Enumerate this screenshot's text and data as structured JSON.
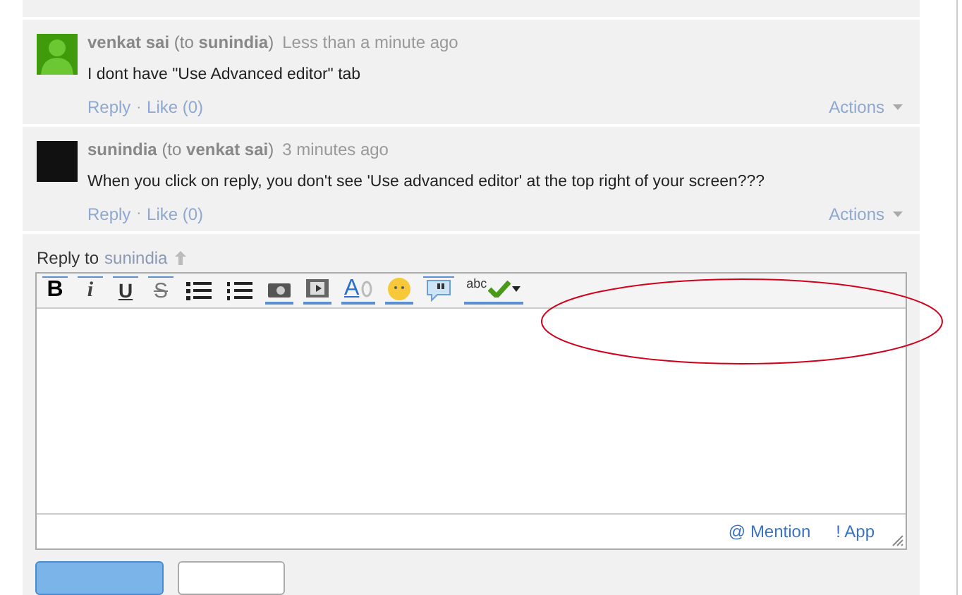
{
  "comments": [
    {
      "kind": "silhouette",
      "author": "venkat sai",
      "to_open": "(to",
      "to": "sunindia",
      "to_close": ")",
      "time": "Less than a minute ago",
      "body": "I dont have \"Use Advanced editor\" tab",
      "reply": "Reply",
      "separator": "·",
      "like": "Like (0)",
      "actions": "Actions"
    },
    {
      "kind": "photo",
      "author": "sunindia",
      "to_open": "(to",
      "to": "venkat sai",
      "to_close": ")",
      "time": "3 minutes ago",
      "body": "When you click on reply, you don't see 'Use advanced editor' at the top right of your screen???",
      "reply": "Reply",
      "separator": "·",
      "like": "Like (0)",
      "actions": "Actions"
    }
  ],
  "reply": {
    "label": "Reply to",
    "target": "sunindia"
  },
  "toolbar": [
    {
      "kind": "bold",
      "label": "B"
    },
    {
      "kind": "italic",
      "label": "i"
    },
    {
      "kind": "underline",
      "label": "U"
    },
    {
      "kind": "strike",
      "label": "S"
    },
    {
      "kind": "bullets"
    },
    {
      "kind": "numbers"
    },
    {
      "kind": "photo"
    },
    {
      "kind": "video"
    },
    {
      "kind": "link",
      "label": "A"
    },
    {
      "kind": "emoji"
    },
    {
      "kind": "quote"
    },
    {
      "kind": "spell",
      "label": "abc"
    }
  ],
  "footer": [
    "@ Mention",
    "! App"
  ],
  "annotation": {
    "kind": "ellipse",
    "color": "#d0021b"
  }
}
